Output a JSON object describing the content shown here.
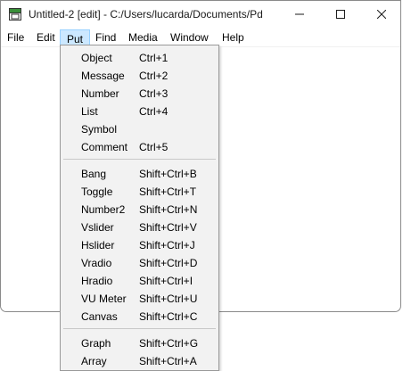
{
  "window": {
    "title": "Untitled-2  [edit] - C:/Users/lucarda/Documents/Pd",
    "icons": {
      "app": "pd-app-icon",
      "minimize": "minimize-icon",
      "maximize": "maximize-icon",
      "close": "close-icon"
    }
  },
  "menubar": {
    "items": [
      "File",
      "Edit",
      "Put",
      "Find",
      "Media",
      "Window",
      "Help"
    ],
    "active": "Put"
  },
  "put_menu": {
    "groups": [
      [
        {
          "label": "Object",
          "shortcut": "Ctrl+1"
        },
        {
          "label": "Message",
          "shortcut": "Ctrl+2"
        },
        {
          "label": "Number",
          "shortcut": "Ctrl+3"
        },
        {
          "label": "List",
          "shortcut": "Ctrl+4"
        },
        {
          "label": "Symbol",
          "shortcut": ""
        },
        {
          "label": "Comment",
          "shortcut": "Ctrl+5"
        }
      ],
      [
        {
          "label": "Bang",
          "shortcut": "Shift+Ctrl+B"
        },
        {
          "label": "Toggle",
          "shortcut": "Shift+Ctrl+T"
        },
        {
          "label": "Number2",
          "shortcut": "Shift+Ctrl+N"
        },
        {
          "label": "Vslider",
          "shortcut": "Shift+Ctrl+V"
        },
        {
          "label": "Hslider",
          "shortcut": "Shift+Ctrl+J"
        },
        {
          "label": "Vradio",
          "shortcut": "Shift+Ctrl+D"
        },
        {
          "label": "Hradio",
          "shortcut": "Shift+Ctrl+I"
        },
        {
          "label": "VU Meter",
          "shortcut": "Shift+Ctrl+U"
        },
        {
          "label": "Canvas",
          "shortcut": "Shift+Ctrl+C"
        }
      ],
      [
        {
          "label": "Graph",
          "shortcut": "Shift+Ctrl+G"
        },
        {
          "label": "Array",
          "shortcut": "Shift+Ctrl+A"
        }
      ]
    ]
  }
}
